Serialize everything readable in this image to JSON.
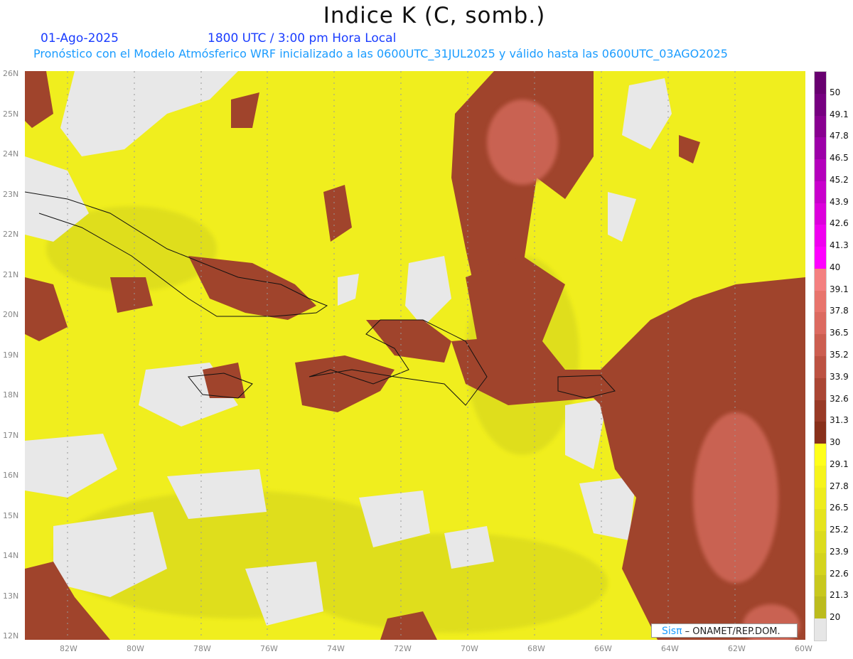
{
  "header": {
    "title": "Indice K (C, somb.)",
    "date": "01-Ago-2025",
    "time": "1800 UTC / 3:00 pm Hora Local",
    "description": "Pronóstico con el Modelo Atmósferico WRF inicializado a las 0600UTC_31JUL2025 y válido hasta las  0600UTC_03AGO2025"
  },
  "map": {
    "lat_labels": [
      "26N",
      "25N",
      "24N",
      "23N",
      "22N",
      "21N",
      "20N",
      "19N",
      "18N",
      "17N",
      "16N",
      "15N",
      "14N",
      "13N",
      "12N"
    ],
    "lon_labels": [
      "82W",
      "80W",
      "78W",
      "76W",
      "74W",
      "72W",
      "70W",
      "68W",
      "66W",
      "64W",
      "62W",
      "60W"
    ]
  },
  "colorbar": {
    "labels": [
      "50",
      "49.1",
      "47.8",
      "46.5",
      "45.2",
      "43.9",
      "42.6",
      "41.3",
      "40",
      "39.1",
      "37.8",
      "36.5",
      "35.2",
      "33.9",
      "32.6",
      "31.3",
      "30",
      "29.1",
      "27.8",
      "26.5",
      "25.2",
      "23.9",
      "22.6",
      "21.3",
      "20"
    ],
    "colors": [
      "#680070",
      "#760080",
      "#880090",
      "#9c00a8",
      "#b400bc",
      "#c800cc",
      "#dc00dc",
      "#f000f0",
      "#ff00ff",
      "#f48080",
      "#e8746c",
      "#dc6a60",
      "#cc5e50",
      "#bc5242",
      "#aa4634",
      "#983a26",
      "#88301a",
      "#ffff1a",
      "#f6f41c",
      "#eeec1e",
      "#e6e41e",
      "#dcdc1e",
      "#d4d41e",
      "#c8c81e",
      "#bcbc1e",
      "#e6e6e6"
    ]
  },
  "credit": {
    "logo": "Sisπ",
    "text": " –  ONAMET/REP.DOM."
  }
}
